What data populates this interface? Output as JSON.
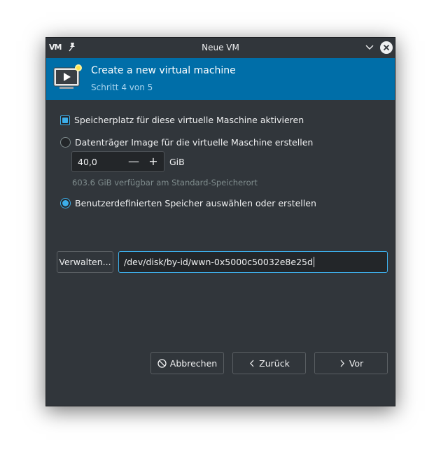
{
  "window": {
    "title": "Neue VM",
    "logo_text": "VM",
    "icons": {
      "logo": "virt-manager-logo-icon",
      "pin": "pin-icon",
      "minimize": "chevron-down-icon",
      "close": "close-icon"
    }
  },
  "banner": {
    "title": "Create a new virtual machine",
    "subtitle": "Schritt 4 von 5",
    "icon": "monitor-play-icon",
    "background_color": "#006ea8"
  },
  "storage": {
    "enable_checkbox_label": "Speicherplatz für diese virtuelle Maschine aktivieren",
    "enable_checked": true,
    "create_image_label": "Datenträger Image für die virtuelle Maschine erstellen",
    "create_image_selected": false,
    "size_value": "40,0",
    "size_unit": "GiB",
    "minus_symbol": "—",
    "plus_symbol": "+",
    "available_hint": "603.6 GiB verfügbar am Standard-Speicherort",
    "custom_label": "Benutzerdefinierten Speicher auswählen oder erstellen",
    "custom_selected": true,
    "manage_button": "Verwalten...",
    "path_value": "/dev/disk/by-id/wwn-0x5000c50032e8e25d"
  },
  "footer": {
    "cancel_label": "Abbrechen",
    "back_label": "Zurück",
    "forward_label": "Vor"
  },
  "colors": {
    "accent": "#3daee9",
    "window_bg": "#31363b",
    "field_bg": "#232629",
    "text": "#eff0f1",
    "muted_text": "#7f8c8d"
  }
}
